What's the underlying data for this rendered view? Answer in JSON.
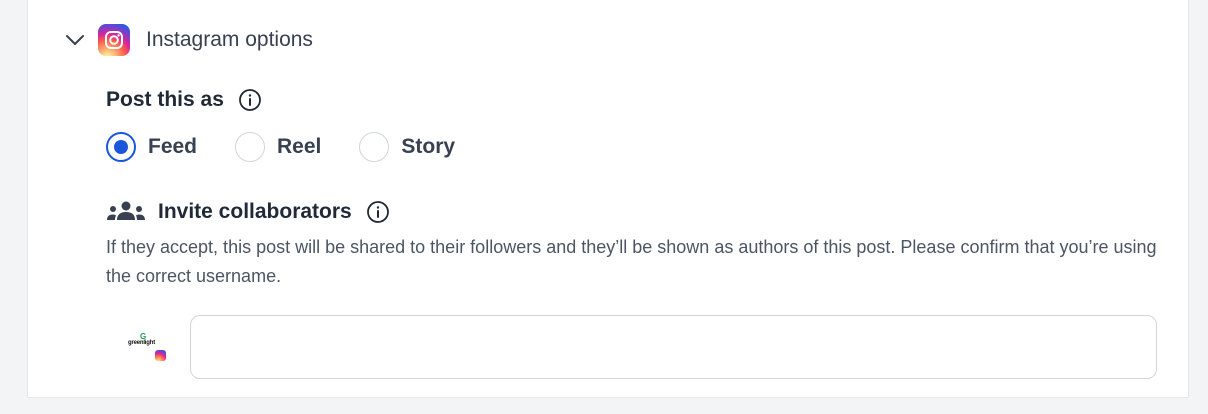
{
  "section": {
    "title": "Instagram options"
  },
  "post_as": {
    "label": "Post this as",
    "options": [
      {
        "label": "Feed",
        "checked": true
      },
      {
        "label": "Reel",
        "checked": false
      },
      {
        "label": "Story",
        "checked": false
      }
    ]
  },
  "collaborators": {
    "label": "Invite collaborators",
    "description": "If they accept, this post will be shared to their followers and they’ll be shown as authors of this post. Please confirm that you’re using the correct username.",
    "avatar_text": "greenlight",
    "avatar_letter": "G",
    "input_value": "",
    "input_placeholder": ""
  },
  "colors": {
    "accent": "#1a56db",
    "brand_green": "#16a34a"
  },
  "icons": {
    "chevron": "chevron-down-icon",
    "instagram": "instagram-icon",
    "info": "info-icon",
    "people": "people-icon"
  }
}
